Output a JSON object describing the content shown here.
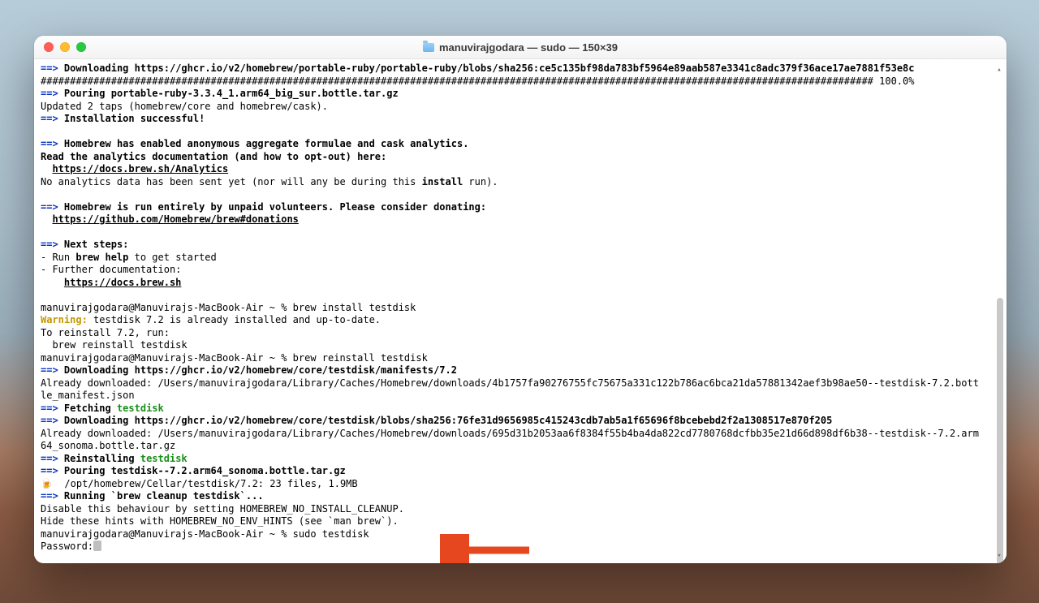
{
  "window": {
    "title": "manuvirajgodara — sudo — 150×39"
  },
  "term": {
    "arrow": "==>",
    "dl1": "Downloading https://ghcr.io/v2/homebrew/portable-ruby/portable-ruby/blobs/sha256:ce5c135bf98da783bf5964e89aab587e3341c8adc379f36ace17ae7881f53e8c",
    "hashline": "############################################################################################################################################## 100.0%",
    "pour1": "Pouring portable-ruby-3.3.4_1.arm64_big_sur.bottle.tar.gz",
    "updated": "Updated 2 taps (homebrew/core and homebrew/cask).",
    "install_ok": "Installation successful!",
    "analytics_head": "Homebrew has enabled anonymous aggregate formulae and cask analytics.",
    "analytics_read": "Read the analytics documentation (and how to opt-out) here:",
    "analytics_url": "https://docs.brew.sh/Analytics",
    "no_analytics_a": "No analytics data has been sent yet (nor will any be during this ",
    "no_analytics_b": "install",
    "no_analytics_c": " run).",
    "donate_head": "Homebrew is run entirely by unpaid volunteers. Please consider donating:",
    "donate_url": "https://github.com/Homebrew/brew#donations",
    "next_steps": "Next steps:",
    "run_a": "- Run ",
    "run_b": "brew help",
    "run_c": " to get started",
    "further": "- Further documentation:",
    "docs_url": "https://docs.brew.sh",
    "prompt1": "manuvirajgodara@Manuvirajs-MacBook-Air ~ % brew install testdisk",
    "warning_label": "Warning:",
    "warning_txt": " testdisk 7.2 is already installed and up-to-date.",
    "to_reinstall": "To reinstall 7.2, run:",
    "reinstall_cmd": "  brew reinstall testdisk",
    "prompt2": "manuvirajgodara@Manuvirajs-MacBook-Air ~ % brew reinstall testdisk",
    "dl2": "Downloading https://ghcr.io/v2/homebrew/core/testdisk/manifests/7.2",
    "already1": "Already downloaded: /Users/manuvirajgodara/Library/Caches/Homebrew/downloads/4b1757fa90276755fc75675a331c122b786ac6bca21da57881342aef3b98ae50--testdisk-7.2.bottle_manifest.json",
    "fetching": "Fetching",
    "testdisk": "testdisk",
    "dl3": "Downloading https://ghcr.io/v2/homebrew/core/testdisk/blobs/sha256:76fe31d9656985c415243cdb7ab5a1f65696f8bcebebd2f2a1308517e870f205",
    "already2": "Already downloaded: /Users/manuvirajgodara/Library/Caches/Homebrew/downloads/695d31b2053aa6f8384f55b4ba4da822cd7780768dcfbb35e21d66d898df6b38--testdisk--7.2.arm64_sonoma.bottle.tar.gz",
    "reinstalling": "Reinstalling",
    "pour2": "Pouring testdisk--7.2.arm64_sonoma.bottle.tar.gz",
    "beer": "🍺  /opt/homebrew/Cellar/testdisk/7.2: 23 files, 1.9MB",
    "cleanup": "Running `brew cleanup testdisk`...",
    "disable": "Disable this behaviour by setting HOMEBREW_NO_INSTALL_CLEANUP.",
    "hide": "Hide these hints with HOMEBREW_NO_ENV_HINTS (see `man brew`).",
    "prompt3": "manuvirajgodara@Manuvirajs-MacBook-Air ~ % sudo testdisk",
    "password": "Password:"
  }
}
